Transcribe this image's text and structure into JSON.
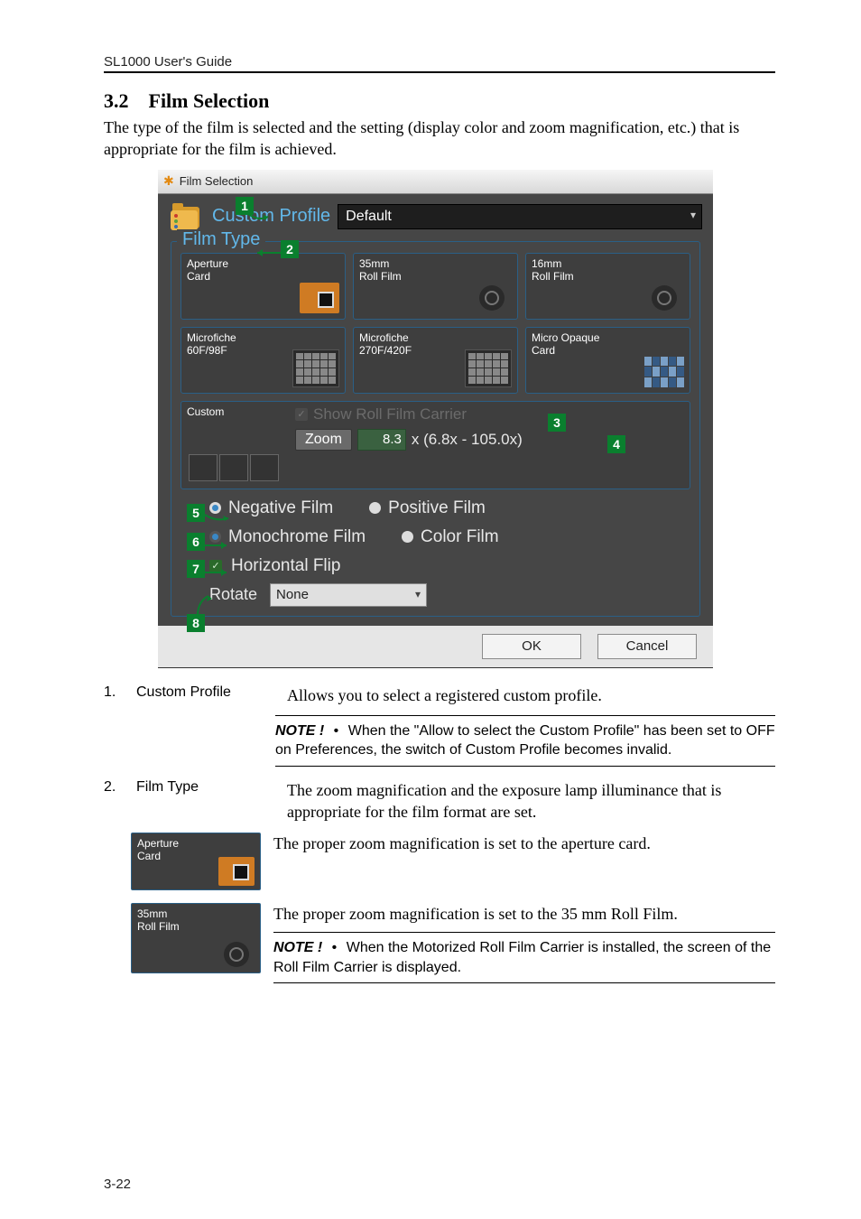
{
  "header": {
    "product_line": "SL1000 User's Guide"
  },
  "section": {
    "number": "3.2",
    "title": "Film Selection",
    "intro": "The type of the film is selected and the setting (display color and zoom magnification, etc.) that is appropriate for the film is achieved."
  },
  "dialog": {
    "title": "Film Selection",
    "profile_label": "Custom Profile",
    "profile_value": "Default",
    "film_type_label": "Film Type",
    "cards": {
      "aperture": {
        "l1": "Aperture",
        "l2": "Card"
      },
      "mm35": {
        "l1": "35mm",
        "l2": "Roll Film"
      },
      "mm16": {
        "l1": "16mm",
        "l2": "Roll Film"
      },
      "fiche60": {
        "l1": "Microfiche",
        "l2": "60F/98F"
      },
      "fiche270": {
        "l1": "Microfiche",
        "l2": "270F/420F"
      },
      "opaque": {
        "l1": "Micro Opaque",
        "l2": "Card"
      },
      "custom": {
        "l1": "Custom"
      }
    },
    "show_roll": "Show Roll Film Carrier",
    "zoom_label": "Zoom",
    "zoom_value": "8.3",
    "zoom_range": "x (6.8x - 105.0x)",
    "neg": "Negative Film",
    "pos": "Positive Film",
    "mono": "Monochrome Film",
    "color": "Color Film",
    "hflip": "Horizontal Flip",
    "rotate_label": "Rotate",
    "rotate_value": "None",
    "ok": "OK",
    "cancel": "Cancel"
  },
  "callouts": {
    "n1": "1",
    "n2": "2",
    "n3": "3",
    "n4": "4",
    "n5": "5",
    "n6": "6",
    "n7": "7",
    "n8": "8"
  },
  "defs": {
    "d1_num": "1.",
    "d1_term": "Custom Profile",
    "d1_text": "Allows you to select a registered custom profile.",
    "note1_lead": "NOTE !",
    "note1_text": "When the \"Allow to select the Custom Profile\" has been set to OFF on Preferences, the switch of Custom Profile becomes invalid.",
    "d2_num": "2.",
    "d2_term": "Film Type",
    "d2_text": "The zoom magnification and the exposure lamp illuminance that is appropriate for the film format are set.",
    "sample_ap_l1": "Aperture",
    "sample_ap_l2": "Card",
    "sample_ap_desc": "The proper zoom magnification is set to the aperture card.",
    "sample_35_l1": "35mm",
    "sample_35_l2": "Roll Film",
    "sample_35_desc": "The proper zoom magnification is set to the 35 mm Roll Film.",
    "note2_lead": "NOTE !",
    "note2_text": "When the Motorized Roll Film Carrier is installed, the screen of the Roll Film Carrier is displayed."
  },
  "page_number": "3-22"
}
